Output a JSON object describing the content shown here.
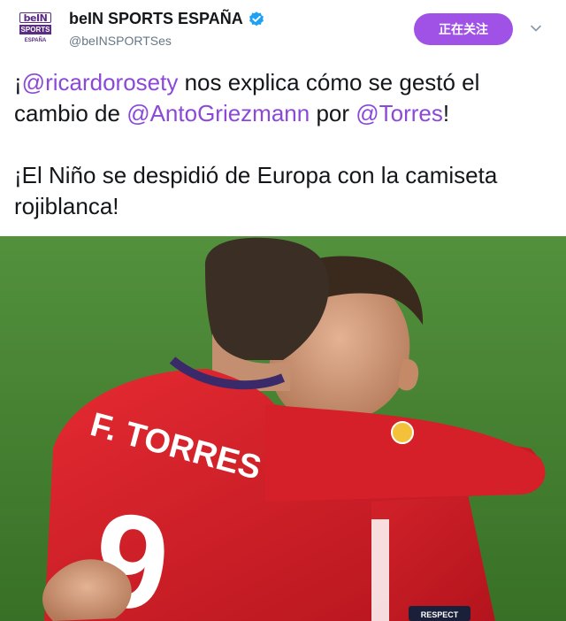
{
  "account": {
    "display_name": "beIN SPORTS ESPAÑA",
    "handle": "@beINSPORTSes",
    "logo": {
      "line1": "beIN",
      "line2": "SPORTS",
      "line3": "ESPAÑA"
    },
    "verified": true
  },
  "follow_button": {
    "label": "正在关注",
    "color": "#a052e6"
  },
  "tweet": {
    "paragraph1": {
      "prefix": "¡",
      "mention1": "@ricardorosety",
      "text1": " nos explica cómo se gestó el cambio de ",
      "mention2": "@AntoGriezmann",
      "text2": " por ",
      "mention3": "@Torres",
      "suffix": "!"
    },
    "paragraph2": "¡El Niño se despidió de Europa con la camiseta rojiblanca!"
  },
  "photo": {
    "jersey_name": "F. TORRES",
    "jersey_number": "9",
    "sleeve_patch": "RESPECT"
  },
  "colors": {
    "mention": "#8c49d8",
    "handle": "#657786",
    "verified": "#1da1f2",
    "jersey_red": "#d8202a",
    "pitch_green": "#4a8a36"
  }
}
